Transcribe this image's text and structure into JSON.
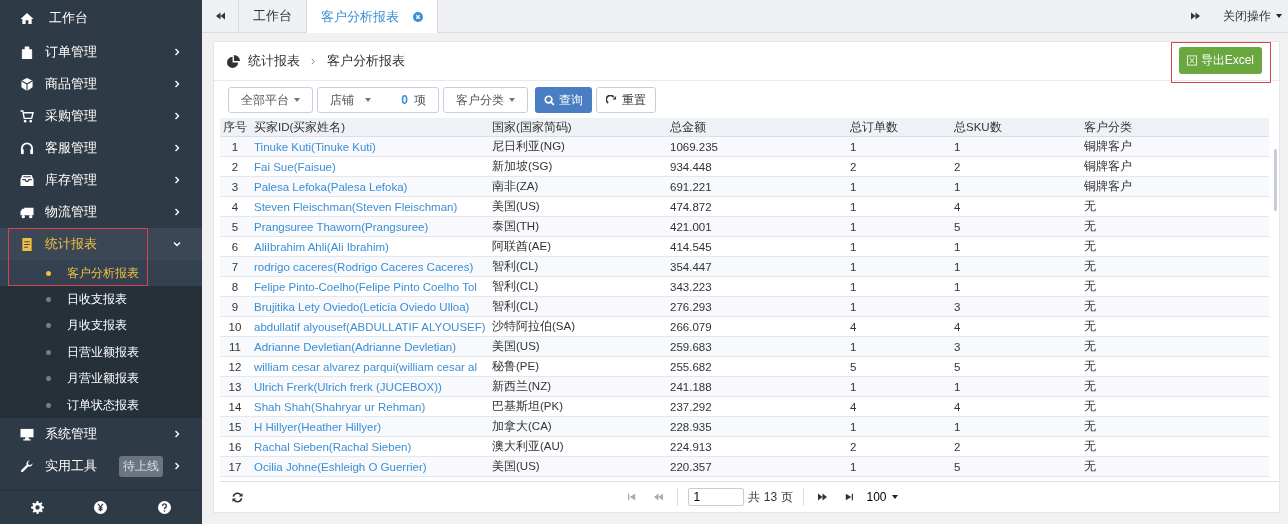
{
  "sidebar": {
    "items": [
      {
        "label": "工作台",
        "kind": "link"
      },
      {
        "label": "订单管理",
        "kind": "menu",
        "expanded": false
      },
      {
        "label": "商品管理",
        "kind": "menu",
        "expanded": false
      },
      {
        "label": "采购管理",
        "kind": "menu",
        "expanded": false
      },
      {
        "label": "客服管理",
        "kind": "menu",
        "expanded": false
      },
      {
        "label": "库存管理",
        "kind": "menu",
        "expanded": false
      },
      {
        "label": "物流管理",
        "kind": "menu",
        "expanded": false
      },
      {
        "label": "统计报表",
        "kind": "menu",
        "expanded": true,
        "highlighted": true,
        "children": [
          {
            "label": "客户分析报表",
            "selected": true
          },
          {
            "label": "日收支报表",
            "selected": false
          },
          {
            "label": "月收支报表",
            "selected": false
          },
          {
            "label": "日营业额报表",
            "selected": false
          },
          {
            "label": "月营业额报表",
            "selected": false
          },
          {
            "label": "订单状态报表",
            "selected": false
          }
        ]
      },
      {
        "label": "系统管理",
        "kind": "menu",
        "expanded": false
      },
      {
        "label": "实用工具",
        "kind": "menu",
        "expanded": false,
        "badge": "待上线"
      }
    ]
  },
  "tabs": [
    {
      "label": "工作台",
      "selected": false
    },
    {
      "label": "客户分析报表",
      "selected": true
    }
  ],
  "close_menu": "关闭操作",
  "breadcrumb": [
    "统计报表",
    "客户分析报表"
  ],
  "export_button": "导出Excel",
  "filters": {
    "platform": "全部平台",
    "shop": "店铺",
    "shop_count": "0",
    "shop_unit": "项",
    "category": "客户分类",
    "query_button": "查询",
    "reset_button": "重置"
  },
  "table": {
    "columns": [
      "序号",
      "买家ID(买家姓名)",
      "国家(国家简码)",
      "总金额",
      "总订单数",
      "总SKU数",
      "客户分类"
    ],
    "rows": [
      [
        "1",
        "Tinuke Kuti(Tinuke Kuti)",
        "尼日利亚(NG)",
        "1069.235",
        "1",
        "1",
        "铜牌客户"
      ],
      [
        "2",
        "Fai Sue(Faisue)",
        "新加坡(SG)",
        "934.448",
        "2",
        "2",
        "铜牌客户"
      ],
      [
        "3",
        "Palesa Lefoka(Palesa Lefoka)",
        "南非(ZA)",
        "691.221",
        "1",
        "1",
        "铜牌客户"
      ],
      [
        "4",
        "Steven Fleischman(Steven Fleischman)",
        "美国(US)",
        "474.872",
        "1",
        "4",
        "无"
      ],
      [
        "5",
        "Prangsuree Thaworn(Prangsuree)",
        "泰国(TH)",
        "421.001",
        "1",
        "5",
        "无"
      ],
      [
        "6",
        "AliIbrahim Ahli(Ali Ibrahim)",
        "阿联酋(AE)",
        "414.545",
        "1",
        "1",
        "无"
      ],
      [
        "7",
        "rodrigo caceres(Rodrigo Caceres Caceres)",
        "智利(CL)",
        "354.447",
        "1",
        "1",
        "无"
      ],
      [
        "8",
        "Felipe Pinto-Coelho(Felipe Pinto Coelho Tol",
        "智利(CL)",
        "343.223",
        "1",
        "1",
        "无"
      ],
      [
        "9",
        "Brujitika Lety Oviedo(Leticia Oviedo Ulloa)",
        "智利(CL)",
        "276.293",
        "1",
        "3",
        "无"
      ],
      [
        "10",
        "abdullatif alyousef(ABDULLATIF ALYOUSEF)",
        "沙特阿拉伯(SA)",
        "266.079",
        "4",
        "4",
        "无"
      ],
      [
        "11",
        "Adrianne Devletian(Adrianne Devletian)",
        "美国(US)",
        "259.683",
        "1",
        "3",
        "无"
      ],
      [
        "12",
        "william cesar alvarez parqui(william cesar al",
        "秘鲁(PE)",
        "255.682",
        "5",
        "5",
        "无"
      ],
      [
        "13",
        "Ulrich Frerk(Ulrich frerk (JUCEBOX))",
        "新西兰(NZ)",
        "241.188",
        "1",
        "1",
        "无"
      ],
      [
        "14",
        "Shah Shah(Shahryar ur Rehman)",
        "巴基斯坦(PK)",
        "237.292",
        "4",
        "4",
        "无"
      ],
      [
        "15",
        "H Hillyer(Heather Hillyer)",
        "加拿大(CA)",
        "228.935",
        "1",
        "1",
        "无"
      ],
      [
        "16",
        "Rachal Sieben(Rachal Sieben)",
        "澳大利亚(AU)",
        "224.913",
        "2",
        "2",
        "无"
      ],
      [
        "17",
        "Ocilia Johne(Eshleigh O Guerrier)",
        "美国(US)",
        "220.357",
        "1",
        "5",
        "无"
      ]
    ]
  },
  "pager": {
    "page": "1",
    "total": "共 13 页",
    "page_size": "100"
  }
}
